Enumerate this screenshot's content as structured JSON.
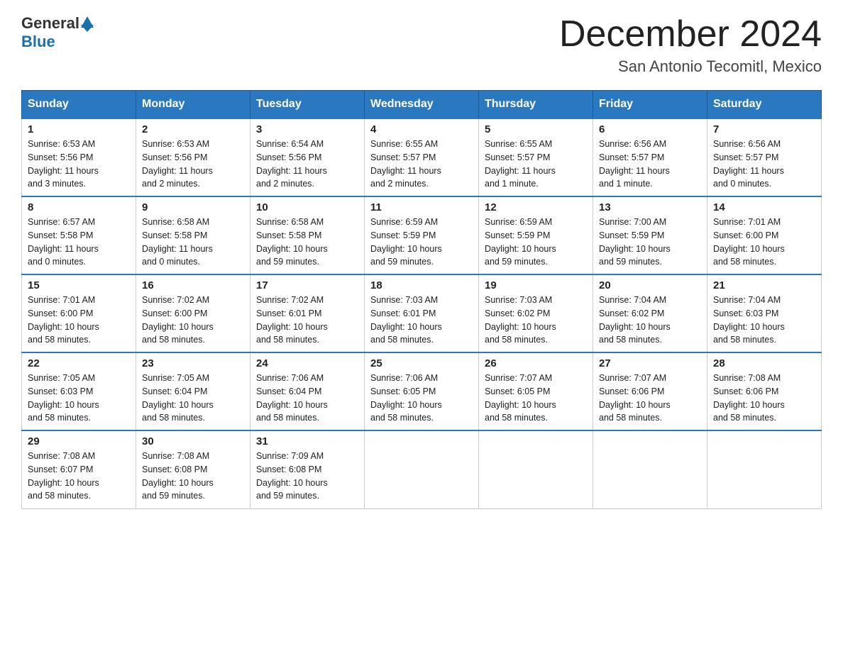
{
  "header": {
    "logo_general": "General",
    "logo_blue": "Blue",
    "title": "December 2024",
    "subtitle": "San Antonio Tecomitl, Mexico"
  },
  "days_of_week": [
    "Sunday",
    "Monday",
    "Tuesday",
    "Wednesday",
    "Thursday",
    "Friday",
    "Saturday"
  ],
  "weeks": [
    [
      {
        "day": "1",
        "sunrise": "6:53 AM",
        "sunset": "5:56 PM",
        "daylight": "11 hours and 3 minutes."
      },
      {
        "day": "2",
        "sunrise": "6:53 AM",
        "sunset": "5:56 PM",
        "daylight": "11 hours and 2 minutes."
      },
      {
        "day": "3",
        "sunrise": "6:54 AM",
        "sunset": "5:56 PM",
        "daylight": "11 hours and 2 minutes."
      },
      {
        "day": "4",
        "sunrise": "6:55 AM",
        "sunset": "5:57 PM",
        "daylight": "11 hours and 2 minutes."
      },
      {
        "day": "5",
        "sunrise": "6:55 AM",
        "sunset": "5:57 PM",
        "daylight": "11 hours and 1 minute."
      },
      {
        "day": "6",
        "sunrise": "6:56 AM",
        "sunset": "5:57 PM",
        "daylight": "11 hours and 1 minute."
      },
      {
        "day": "7",
        "sunrise": "6:56 AM",
        "sunset": "5:57 PM",
        "daylight": "11 hours and 0 minutes."
      }
    ],
    [
      {
        "day": "8",
        "sunrise": "6:57 AM",
        "sunset": "5:58 PM",
        "daylight": "11 hours and 0 minutes."
      },
      {
        "day": "9",
        "sunrise": "6:58 AM",
        "sunset": "5:58 PM",
        "daylight": "11 hours and 0 minutes."
      },
      {
        "day": "10",
        "sunrise": "6:58 AM",
        "sunset": "5:58 PM",
        "daylight": "10 hours and 59 minutes."
      },
      {
        "day": "11",
        "sunrise": "6:59 AM",
        "sunset": "5:59 PM",
        "daylight": "10 hours and 59 minutes."
      },
      {
        "day": "12",
        "sunrise": "6:59 AM",
        "sunset": "5:59 PM",
        "daylight": "10 hours and 59 minutes."
      },
      {
        "day": "13",
        "sunrise": "7:00 AM",
        "sunset": "5:59 PM",
        "daylight": "10 hours and 59 minutes."
      },
      {
        "day": "14",
        "sunrise": "7:01 AM",
        "sunset": "6:00 PM",
        "daylight": "10 hours and 58 minutes."
      }
    ],
    [
      {
        "day": "15",
        "sunrise": "7:01 AM",
        "sunset": "6:00 PM",
        "daylight": "10 hours and 58 minutes."
      },
      {
        "day": "16",
        "sunrise": "7:02 AM",
        "sunset": "6:00 PM",
        "daylight": "10 hours and 58 minutes."
      },
      {
        "day": "17",
        "sunrise": "7:02 AM",
        "sunset": "6:01 PM",
        "daylight": "10 hours and 58 minutes."
      },
      {
        "day": "18",
        "sunrise": "7:03 AM",
        "sunset": "6:01 PM",
        "daylight": "10 hours and 58 minutes."
      },
      {
        "day": "19",
        "sunrise": "7:03 AM",
        "sunset": "6:02 PM",
        "daylight": "10 hours and 58 minutes."
      },
      {
        "day": "20",
        "sunrise": "7:04 AM",
        "sunset": "6:02 PM",
        "daylight": "10 hours and 58 minutes."
      },
      {
        "day": "21",
        "sunrise": "7:04 AM",
        "sunset": "6:03 PM",
        "daylight": "10 hours and 58 minutes."
      }
    ],
    [
      {
        "day": "22",
        "sunrise": "7:05 AM",
        "sunset": "6:03 PM",
        "daylight": "10 hours and 58 minutes."
      },
      {
        "day": "23",
        "sunrise": "7:05 AM",
        "sunset": "6:04 PM",
        "daylight": "10 hours and 58 minutes."
      },
      {
        "day": "24",
        "sunrise": "7:06 AM",
        "sunset": "6:04 PM",
        "daylight": "10 hours and 58 minutes."
      },
      {
        "day": "25",
        "sunrise": "7:06 AM",
        "sunset": "6:05 PM",
        "daylight": "10 hours and 58 minutes."
      },
      {
        "day": "26",
        "sunrise": "7:07 AM",
        "sunset": "6:05 PM",
        "daylight": "10 hours and 58 minutes."
      },
      {
        "day": "27",
        "sunrise": "7:07 AM",
        "sunset": "6:06 PM",
        "daylight": "10 hours and 58 minutes."
      },
      {
        "day": "28",
        "sunrise": "7:08 AM",
        "sunset": "6:06 PM",
        "daylight": "10 hours and 58 minutes."
      }
    ],
    [
      {
        "day": "29",
        "sunrise": "7:08 AM",
        "sunset": "6:07 PM",
        "daylight": "10 hours and 58 minutes."
      },
      {
        "day": "30",
        "sunrise": "7:08 AM",
        "sunset": "6:08 PM",
        "daylight": "10 hours and 59 minutes."
      },
      {
        "day": "31",
        "sunrise": "7:09 AM",
        "sunset": "6:08 PM",
        "daylight": "10 hours and 59 minutes."
      },
      null,
      null,
      null,
      null
    ]
  ],
  "labels": {
    "sunrise": "Sunrise:",
    "sunset": "Sunset:",
    "daylight": "Daylight:"
  }
}
